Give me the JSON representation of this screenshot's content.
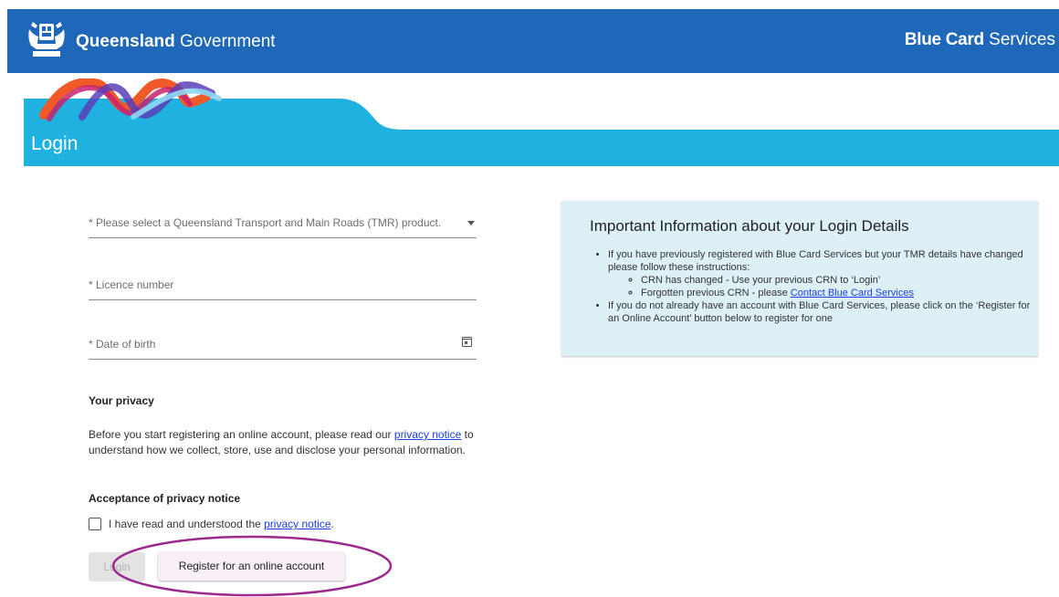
{
  "header": {
    "brand_bold": "Queensland",
    "brand_regular": "Government",
    "service_bold": "Blue Card",
    "service_regular": "Services"
  },
  "banner": {
    "title": "Login"
  },
  "form": {
    "product_placeholder": "* Please select a Queensland Transport and Main Roads (TMR) product.",
    "licence_placeholder": "* Licence number",
    "dob_placeholder": "* Date of birth",
    "privacy_heading": "Your privacy",
    "privacy_text_1": "Before you start registering an online account, please read our",
    "privacy_link": "privacy notice",
    "privacy_text_2": "to understand how we collect, store, use and disclose your personal information.",
    "acceptance_heading": "Acceptance of privacy notice",
    "checkbox_text": "I have read and understood the",
    "checkbox_link": "privacy notice",
    "checkbox_end": ".",
    "login_label": "Login",
    "register_label": "Register for an online account"
  },
  "info": {
    "title": "Important Information about your Login Details",
    "bullet1": "If you have previously registered with Blue Card Services but your TMR details have changed please follow these instructions:",
    "sub1": "CRN has changed - Use your previous CRN to ‘Login’",
    "sub2_text": "Forgotten previous CRN - please",
    "sub2_link": "Contact Blue Card Services",
    "bullet2": "If you do not already have an account with Blue Card Services, please click on the ‘Register for an Online Account’ button below to register for one"
  },
  "colors": {
    "header_bg": "#1f67b8",
    "banner_cyan": "#1fb1e0",
    "info_bg": "#dcf0f6",
    "highlight_ring": "#9c2a8e",
    "link": "#1a3fe0"
  },
  "icons": {
    "crest": "queensland-crest-icon",
    "dropdown": "caret-down-icon",
    "calendar": "calendar-icon",
    "checkbox": "checkbox-icon"
  }
}
